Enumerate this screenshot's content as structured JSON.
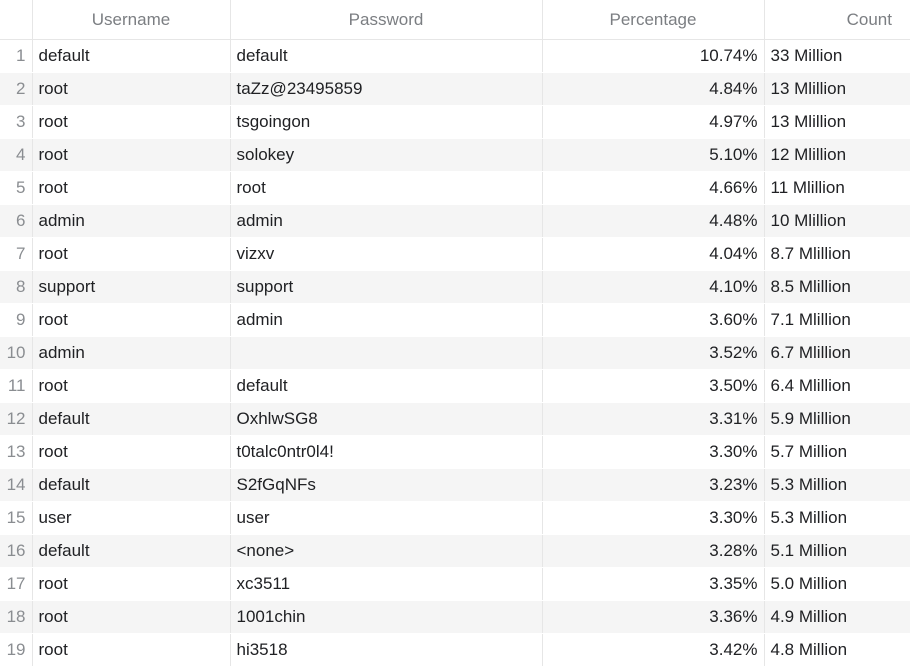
{
  "headers": {
    "username": "Username",
    "password": "Password",
    "percentage": "Percentage",
    "count": "Count"
  },
  "rows": [
    {
      "index": "1",
      "username": "default",
      "password": "default",
      "percentage": "10.74%",
      "count": "33 Million"
    },
    {
      "index": "2",
      "username": "root",
      "password": "taZz@23495859",
      "percentage": "4.84%",
      "count": "13 Mlillion"
    },
    {
      "index": "3",
      "username": "root",
      "password": "tsgoingon",
      "percentage": "4.97%",
      "count": "13 Mlillion"
    },
    {
      "index": "4",
      "username": "root",
      "password": "solokey",
      "percentage": "5.10%",
      "count": "12 Mlillion"
    },
    {
      "index": "5",
      "username": "root",
      "password": "root",
      "percentage": "4.66%",
      "count": "11 Mlillion"
    },
    {
      "index": "6",
      "username": "admin",
      "password": "admin",
      "percentage": "4.48%",
      "count": "10 Mlillion"
    },
    {
      "index": "7",
      "username": "root",
      "password": "vizxv",
      "percentage": "4.04%",
      "count": "8.7 Mlillion"
    },
    {
      "index": "8",
      "username": "support",
      "password": "support",
      "percentage": "4.10%",
      "count": "8.5 Mlillion"
    },
    {
      "index": "9",
      "username": "root",
      "password": "admin",
      "percentage": "3.60%",
      "count": "7.1 Mlillion"
    },
    {
      "index": "10",
      "username": "admin",
      "password": "",
      "percentage": "3.52%",
      "count": "6.7 Mlillion"
    },
    {
      "index": "11",
      "username": "root",
      "password": "default",
      "percentage": "3.50%",
      "count": "6.4 Mlillion"
    },
    {
      "index": "12",
      "username": "default",
      "password": "OxhlwSG8",
      "percentage": "3.31%",
      "count": "5.9 Mlillion"
    },
    {
      "index": "13",
      "username": "root",
      "password": "t0talc0ntr0l4!",
      "percentage": "3.30%",
      "count": "5.7 Million"
    },
    {
      "index": "14",
      "username": "default",
      "password": "S2fGqNFs",
      "percentage": "3.23%",
      "count": "5.3 Million"
    },
    {
      "index": "15",
      "username": "user",
      "password": "user",
      "percentage": "3.30%",
      "count": "5.3 Million"
    },
    {
      "index": "16",
      "username": "default",
      "password": "<none>",
      "percentage": "3.28%",
      "count": "5.1 Million"
    },
    {
      "index": "17",
      "username": "root",
      "password": "xc3511",
      "percentage": "3.35%",
      "count": "5.0 Million"
    },
    {
      "index": "18",
      "username": "root",
      "password": "1001chin",
      "percentage": "3.36%",
      "count": "4.9 Million"
    },
    {
      "index": "19",
      "username": "root",
      "password": "hi3518",
      "percentage": "3.42%",
      "count": "4.8 Million"
    }
  ]
}
